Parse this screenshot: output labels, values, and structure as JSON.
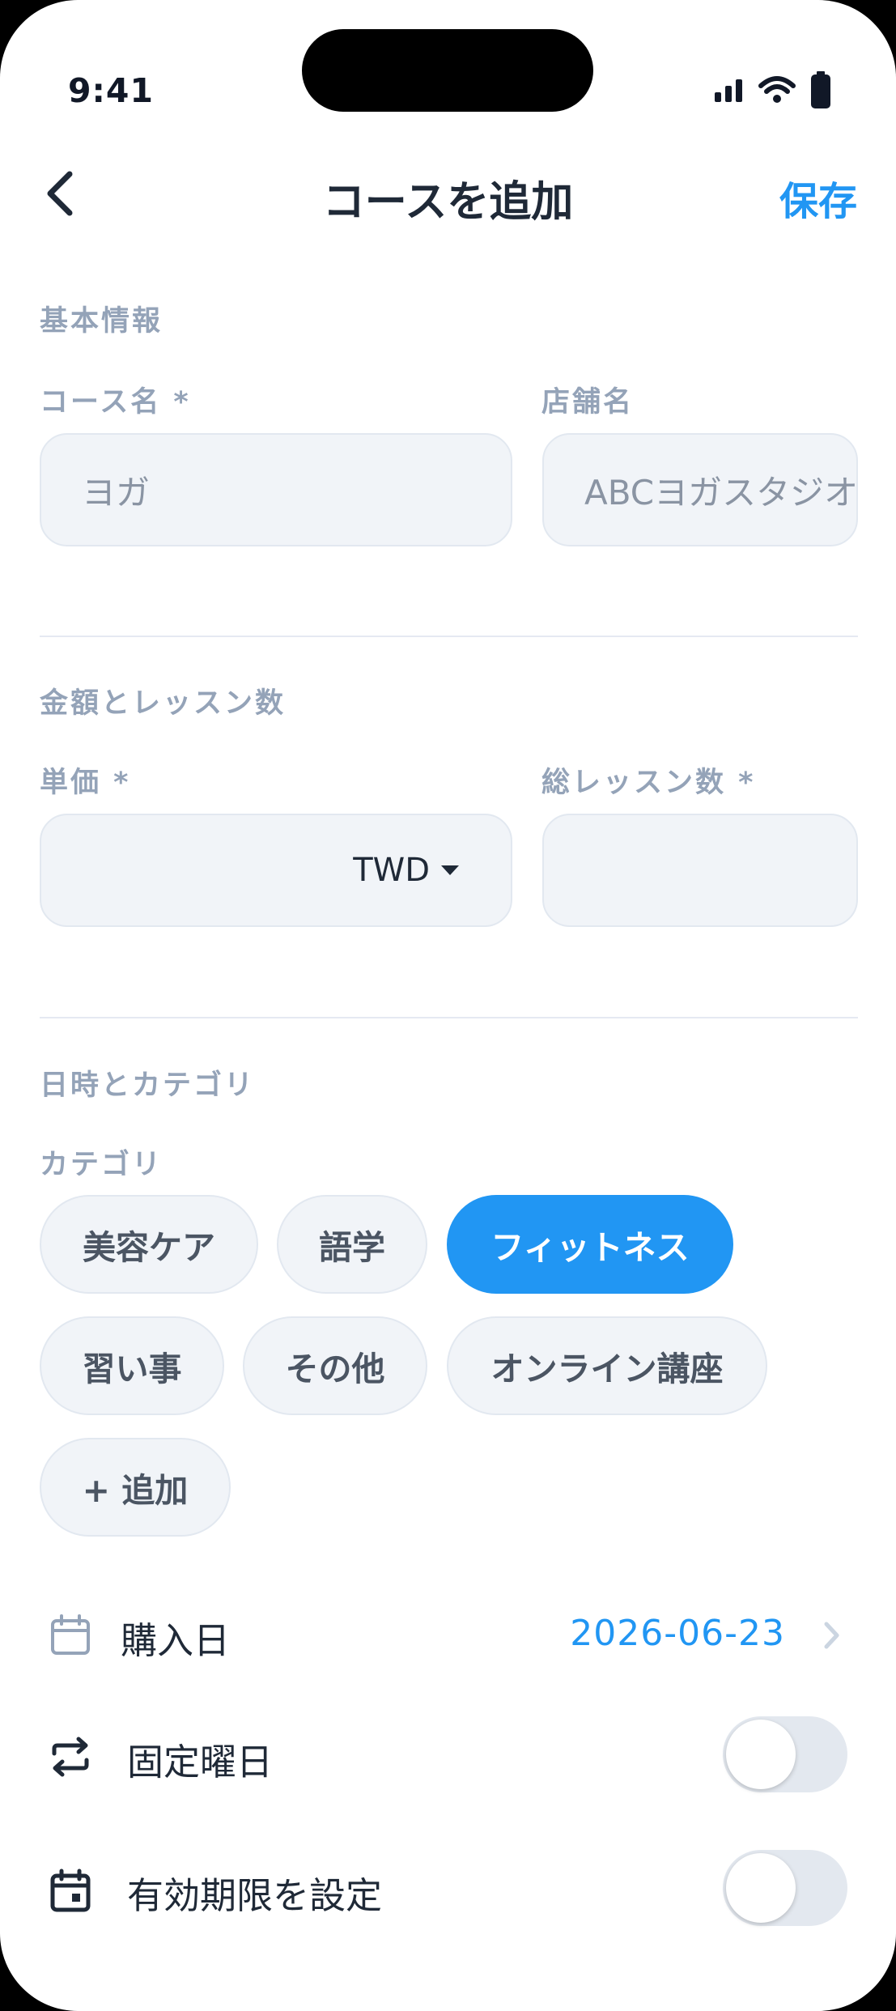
{
  "status_bar": {
    "time": "9:41"
  },
  "nav": {
    "title": "コースを追加",
    "save_label": "保存"
  },
  "basic_info": {
    "section_title": "基本情報",
    "course_name_label": "コース名 *",
    "course_name_placeholder": "ヨガ",
    "store_name_label": "店舗名",
    "store_name_placeholder": "ABCヨガスタジオ"
  },
  "price": {
    "section_title": "金額とレッスン数",
    "unit_price_label": "単価 *",
    "currency": "TWD",
    "total_lessons_label": "総レッスン数 *"
  },
  "schedule": {
    "section_title": "日時とカテゴリ",
    "category_label": "カテゴリ",
    "categories": [
      {
        "label": "美容ケア",
        "active": false
      },
      {
        "label": "語学",
        "active": false
      },
      {
        "label": "フィットネス",
        "active": true
      },
      {
        "label": "習い事",
        "active": false
      },
      {
        "label": "その他",
        "active": false
      },
      {
        "label": "オンライン講座",
        "active": false
      },
      {
        "label": "+ 追加",
        "active": false
      }
    ],
    "purchase_date_label": "購入日",
    "purchase_date_value": "2026-06-23",
    "fixed_weekday_label": "固定曜日",
    "fixed_weekday_on": false,
    "expiry_label": "有効期限を設定",
    "expiry_on": false
  },
  "colors": {
    "accent": "#2196f3",
    "text_primary": "#1f2937",
    "text_muted": "#94a3b8",
    "field_bg": "#f1f4f8"
  },
  "icons": {
    "back": "chevron-left-icon",
    "calendar": "calendar-icon",
    "repeat": "repeat-icon",
    "event": "calendar-event-icon",
    "chevron": "chevron-right-icon"
  }
}
